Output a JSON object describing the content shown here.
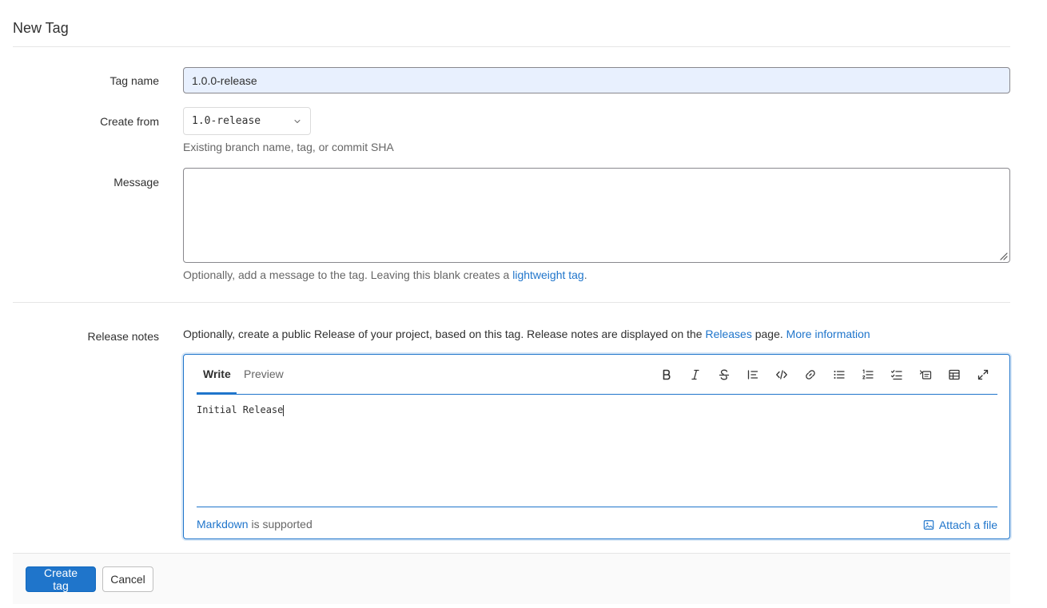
{
  "page": {
    "title": "New Tag"
  },
  "form": {
    "tag_name": {
      "label": "Tag name",
      "value": "1.0.0-release"
    },
    "create_from": {
      "label": "Create from",
      "selected": "1.0-release",
      "help": "Existing branch name, tag, or commit SHA"
    },
    "message": {
      "label": "Message",
      "value": "",
      "help_prefix": "Optionally, add a message to the tag. Leaving this blank creates a ",
      "help_link": "lightweight tag",
      "help_suffix": "."
    },
    "release_notes": {
      "label": "Release notes",
      "intro_prefix": "Optionally, create a public Release of your project, based on this tag. Release notes are displayed on the ",
      "intro_link_releases": "Releases",
      "intro_middle": " page. ",
      "intro_link_more": "More information"
    }
  },
  "editor": {
    "tabs": [
      {
        "label": "Write",
        "active": true
      },
      {
        "label": "Preview",
        "active": false
      }
    ],
    "toolbar": [
      {
        "icon": "bold-icon",
        "tooltip": "Add bold text"
      },
      {
        "icon": "italic-icon",
        "tooltip": "Add italic text"
      },
      {
        "icon": "strikethrough-icon",
        "tooltip": "Add strikethrough text"
      },
      {
        "icon": "quote-icon",
        "tooltip": "Insert a quote"
      },
      {
        "icon": "code-icon",
        "tooltip": "Insert code"
      },
      {
        "icon": "link-icon",
        "tooltip": "Add a link"
      },
      {
        "icon": "bullet-list-icon",
        "tooltip": "Add a bullet list"
      },
      {
        "icon": "numbered-list-icon",
        "tooltip": "Add a numbered list"
      },
      {
        "icon": "task-list-icon",
        "tooltip": "Add a checklist"
      },
      {
        "icon": "collapsible-icon",
        "tooltip": "Add a collapsible section"
      },
      {
        "icon": "table-icon",
        "tooltip": "Add a table"
      },
      {
        "icon": "fullscreen-icon",
        "tooltip": "Go full screen"
      }
    ],
    "content": "Initial Release",
    "footer": {
      "markdown_link": "Markdown",
      "markdown_suffix": " is supported",
      "attach_label": "Attach a file"
    }
  },
  "actions": {
    "create_label": "Create tag",
    "cancel_label": "Cancel"
  },
  "colors": {
    "accent": "#1f75cb",
    "autofill_bg": "#e8f0fe",
    "footer_bg": "#fafafa"
  }
}
